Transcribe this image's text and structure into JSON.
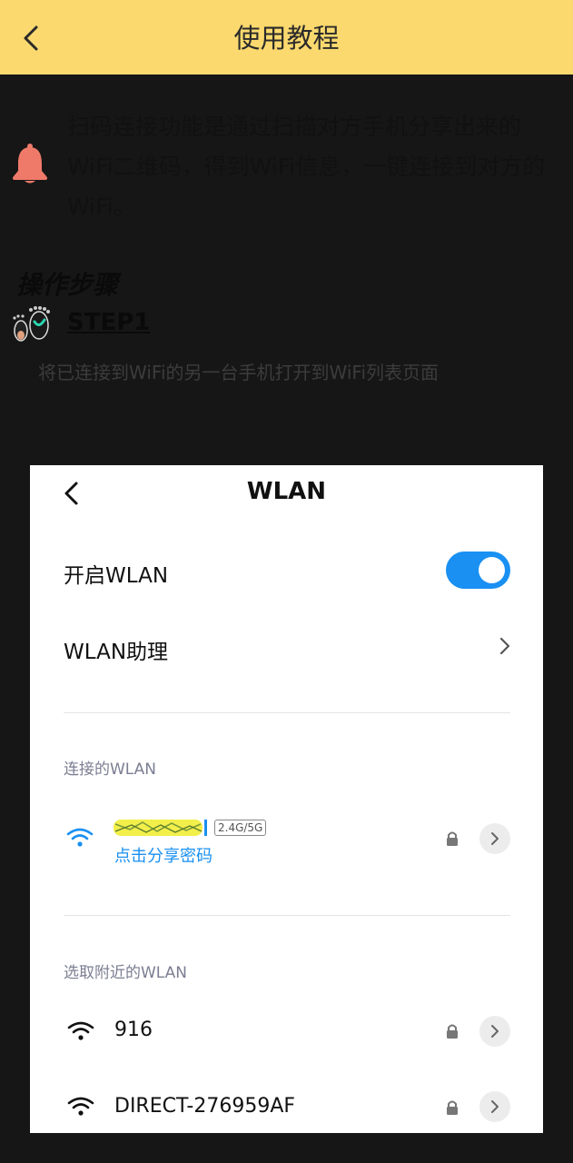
{
  "header": {
    "title": "使用教程",
    "back_icon": "chevron-left-icon"
  },
  "notice": {
    "icon": "bell-icon",
    "icon_color": "#f07a6a",
    "text": "扫码连接功能是通过扫描对方手机分享出来的WiFi二维码，得到WiFi信息，一键连接到对方的WiFi。"
  },
  "steps": {
    "title": "操作步骤",
    "step1": {
      "label": "STEP1",
      "description": "将已连接到WiFi的另一台手机打开到WiFi列表页面"
    }
  },
  "phone": {
    "title": "WLAN",
    "enable_label": "开启WLAN",
    "toggle_on": true,
    "accent": "#1990f2",
    "assistant_label": "WLAN助理",
    "connected_section": "连接的WLAN",
    "connected": {
      "name": "超多钱超多钱",
      "band": "2.4G/5G",
      "share_text": "点击分享密码"
    },
    "nearby_section": "选取附近的WLAN",
    "nearby": [
      {
        "name": "916"
      },
      {
        "name": "DIRECT-276959AF"
      }
    ]
  }
}
